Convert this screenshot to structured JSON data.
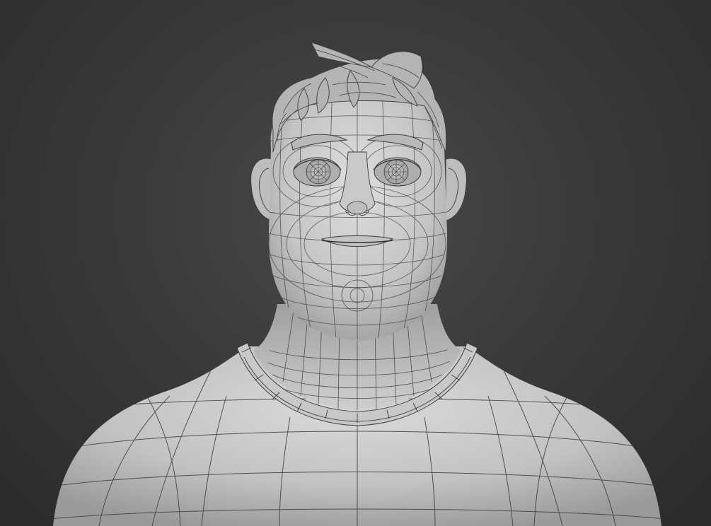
{
  "scene": {
    "subject": "",
    "render_style": "grey clay wireframe",
    "colors": {
      "background_center": "#4a4a4a",
      "background_edge": "#2b2b2b",
      "clay_light": "#d8d8d8",
      "clay_mid": "#b9b9b9",
      "clay_dark": "#8d8d8d",
      "wire": "#3c3c3c"
    }
  }
}
